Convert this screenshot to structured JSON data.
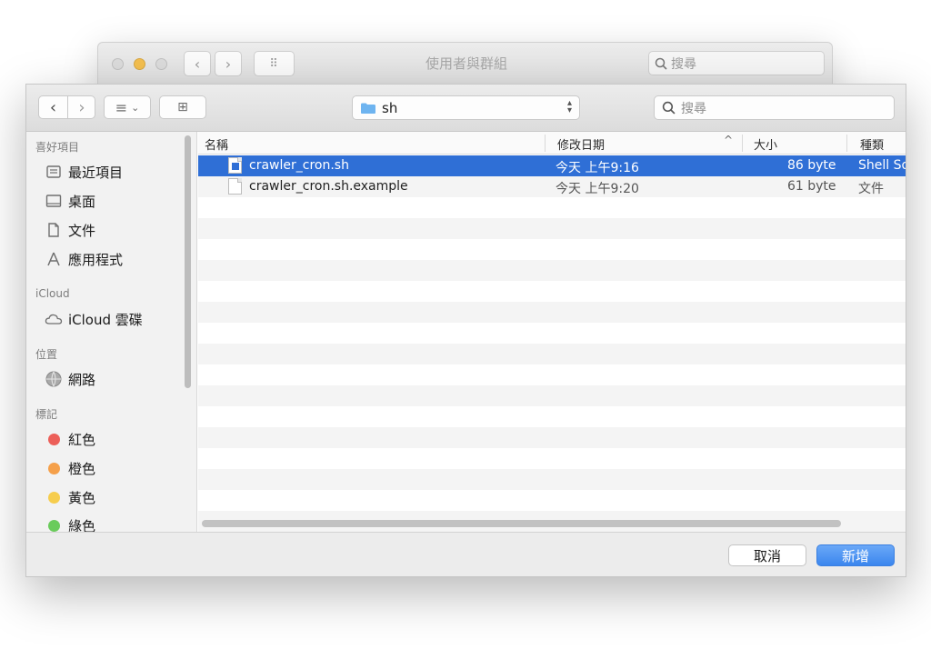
{
  "background_window": {
    "title": "使用者與群組",
    "search_placeholder": "搜尋",
    "back_glyph": "‹",
    "forward_glyph": "›",
    "grid_glyph": "⠿"
  },
  "toolbar": {
    "back_glyph": "‹",
    "forward_glyph": "›",
    "view_glyph": "≡",
    "view_chevron": "⌄",
    "new_folder_glyph": "⊞",
    "path_label": "sh",
    "search_placeholder": "搜尋",
    "search_glyph": "⌕"
  },
  "sidebar": {
    "favorites_header": "喜好項目",
    "favorites": [
      {
        "label": "最近項目",
        "icon": "clock-icon"
      },
      {
        "label": "桌面",
        "icon": "desktop-icon"
      },
      {
        "label": "文件",
        "icon": "documents-icon"
      },
      {
        "label": "應用程式",
        "icon": "applications-icon"
      }
    ],
    "icloud_header": "iCloud",
    "icloud_item": "iCloud 雲碟",
    "locations_header": "位置",
    "network_item": "網路",
    "tags_header": "標記",
    "tags": [
      {
        "label": "紅色",
        "color": "#ec5f59"
      },
      {
        "label": "橙色",
        "color": "#f5a04a"
      },
      {
        "label": "黃色",
        "color": "#f6cd4d"
      },
      {
        "label": "綠色",
        "color": "#6acb5b"
      }
    ]
  },
  "columns": {
    "name": "名稱",
    "date": "修改日期",
    "size": "大小",
    "kind": "種類",
    "sort_glyph": "^"
  },
  "files": [
    {
      "name": "crawler_cron.sh",
      "date": "今天 上午9:16",
      "size": "86 byte",
      "kind": "Shell So",
      "selected": true
    },
    {
      "name": "crawler_cron.sh.example",
      "date": "今天 上午9:20",
      "size": "61 byte",
      "kind": "文件",
      "selected": false
    }
  ],
  "buttons": {
    "cancel": "取消",
    "confirm": "新增"
  },
  "colors": {
    "selection": "#2f6fd6",
    "primary_button": "#3b86ee",
    "folder": "#6eb4f0"
  }
}
